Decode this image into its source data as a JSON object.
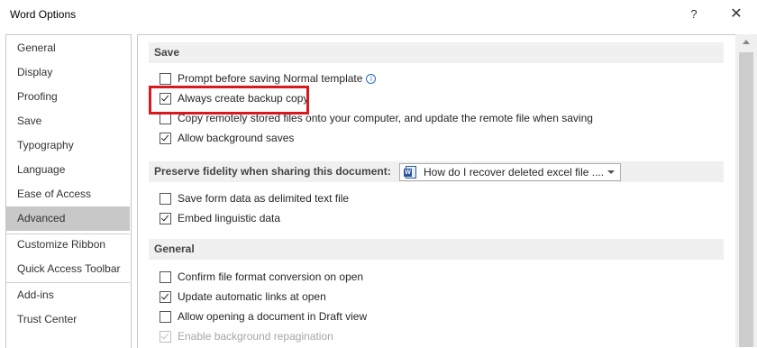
{
  "window": {
    "title": "Word Options",
    "help": "?",
    "close": "✕"
  },
  "sidebar": {
    "items": [
      {
        "label": "General"
      },
      {
        "label": "Display"
      },
      {
        "label": "Proofing"
      },
      {
        "label": "Save"
      },
      {
        "label": "Typography"
      },
      {
        "label": "Language"
      },
      {
        "label": "Ease of Access"
      },
      {
        "label": "Advanced",
        "selected": true
      },
      {
        "label": "Customize Ribbon"
      },
      {
        "label": "Quick Access Toolbar"
      },
      {
        "label": "Add-ins"
      },
      {
        "label": "Trust Center"
      }
    ]
  },
  "save": {
    "header": "Save",
    "options": [
      {
        "label": "Prompt before saving Normal template",
        "checked": false
      },
      {
        "label": "Always create backup copy",
        "checked": true
      },
      {
        "label": "Copy remotely stored files onto your computer, and update the remote file when saving",
        "checked": false
      },
      {
        "label": "Allow background saves",
        "checked": true
      }
    ]
  },
  "fidelity": {
    "header": "Preserve fidelity when sharing this document:",
    "selected_document": "How do I recover deleted excel file ....",
    "options": [
      {
        "label": "Save form data as delimited text file",
        "checked": false
      },
      {
        "label": "Embed linguistic data",
        "checked": true
      }
    ]
  },
  "general": {
    "header": "General",
    "options": [
      {
        "label": "Confirm file format conversion on open",
        "checked": false
      },
      {
        "label": "Update automatic links at open",
        "checked": true
      },
      {
        "label": "Allow opening a document in Draft view",
        "checked": false
      },
      {
        "label": "Enable background repagination",
        "checked": true,
        "disabled": true
      }
    ]
  },
  "colors": {
    "highlight": "#d71920",
    "selected_nav": "#c8c8c8",
    "section_bg": "#f0f0f0"
  }
}
